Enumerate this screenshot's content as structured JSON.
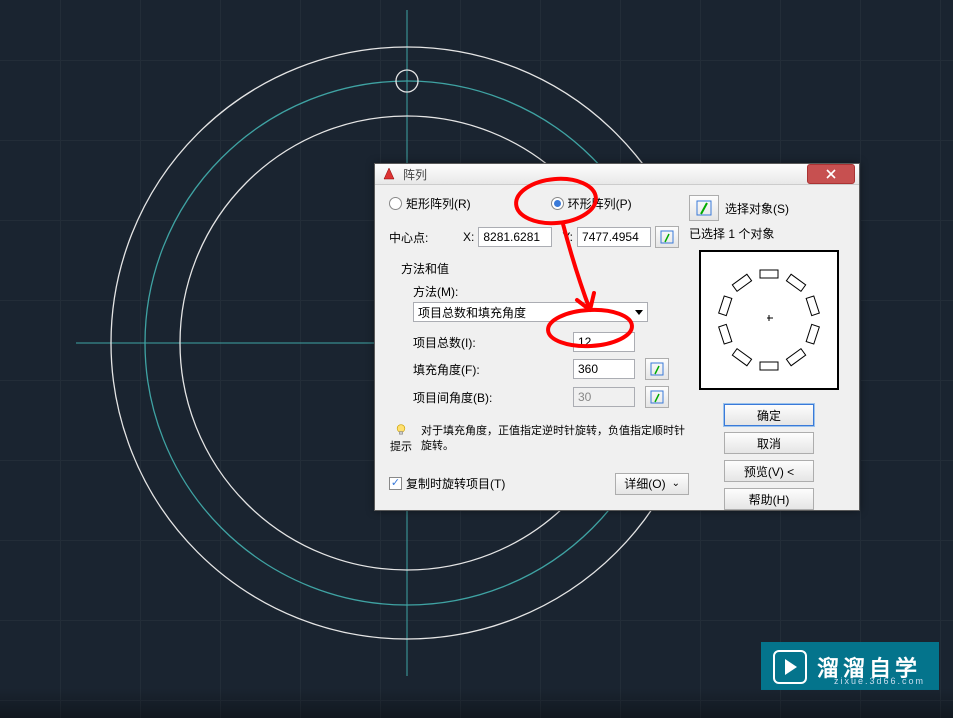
{
  "dialog": {
    "title": "阵列",
    "radio_rect": "矩形阵列(R)",
    "radio_polar": "环形阵列(P)",
    "center_label": "中心点:",
    "x_label": "X:",
    "y_label": "Y:",
    "x_value": "8281.6281",
    "y_value": "7477.4954",
    "method_group_label": "方法和值",
    "method_label": "方法(M):",
    "method_value": "项目总数和填充角度",
    "items_label": "项目总数(I):",
    "items_value": "12",
    "fillangle_label": "填充角度(F):",
    "fillangle_value": "360",
    "itemangle_label": "项目间角度(B):",
    "itemangle_value": "30",
    "tip_text": "对于填充角度，正值指定逆时针旋转，负值指定顺时针旋转。",
    "tip_label": "提示",
    "rotate_items_label": "复制时旋转项目(T)",
    "details_label": "详细(O)",
    "select_objects_label": "选择对象(S)",
    "objects_selected": "已选择 1 个对象",
    "ok": "确定",
    "cancel": "取消",
    "preview": "预览(V) <",
    "help": "帮助(H)"
  },
  "watermark": {
    "text": "溜溜自学",
    "sub": "zixue.3d66.com"
  }
}
